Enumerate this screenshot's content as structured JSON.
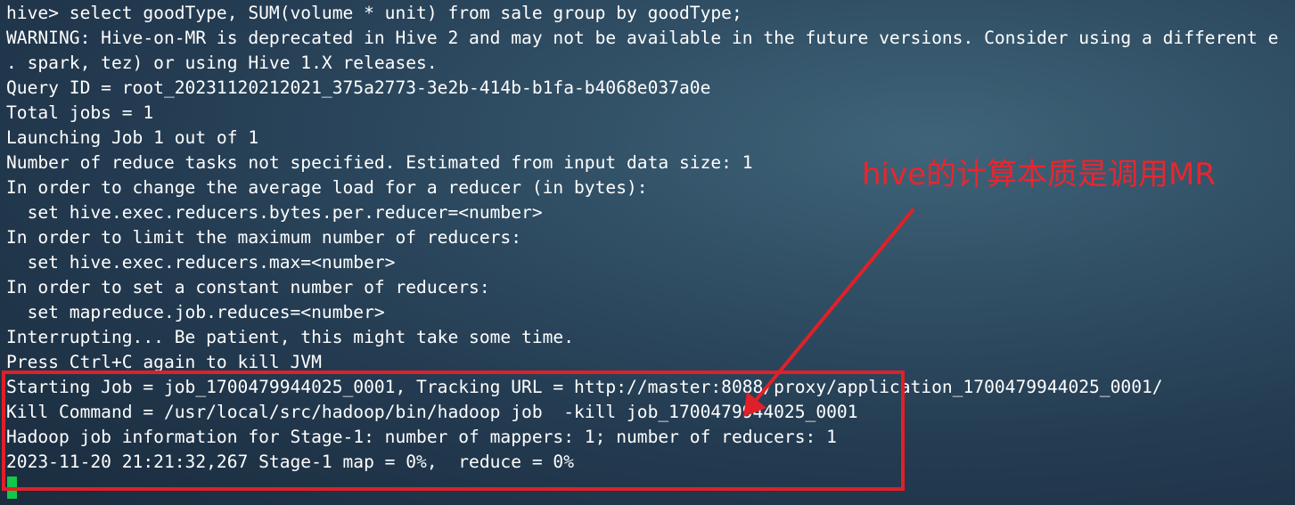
{
  "terminal": {
    "lines": [
      "hive> select goodType, SUM(volume * unit) from sale group by goodType;",
      "WARNING: Hive-on-MR is deprecated in Hive 2 and may not be available in the future versions. Consider using a different e",
      ". spark, tez) or using Hive 1.X releases.",
      "Query ID = root_20231120212021_375a2773-3e2b-414b-b1fa-b4068e037a0e",
      "Total jobs = 1",
      "Launching Job 1 out of 1",
      "Number of reduce tasks not specified. Estimated from input data size: 1",
      "In order to change the average load for a reducer (in bytes):",
      "  set hive.exec.reducers.bytes.per.reducer=<number>",
      "In order to limit the maximum number of reducers:",
      "  set hive.exec.reducers.max=<number>",
      "In order to set a constant number of reducers:",
      "  set mapreduce.job.reduces=<number>",
      "Interrupting... Be patient, this might take some time.",
      "Press Ctrl+C again to kill JVM",
      "Starting Job = job_1700479944025_0001, Tracking URL = http://master:8088/proxy/application_1700479944025_0001/",
      "Kill Command = /usr/local/src/hadoop/bin/hadoop job  -kill job_1700479944025_0001",
      "Hadoop job information for Stage-1: number of mappers: 1; number of reducers: 1",
      "2023-11-20 21:21:32,267 Stage-1 map = 0%,  reduce = 0%"
    ]
  },
  "annotation": {
    "text": "hive的计算本质是调用MR",
    "color": "#e8262f"
  },
  "colors": {
    "text": "#ffffff",
    "cursor": "#12c84a",
    "highlight_border": "#e02028"
  }
}
